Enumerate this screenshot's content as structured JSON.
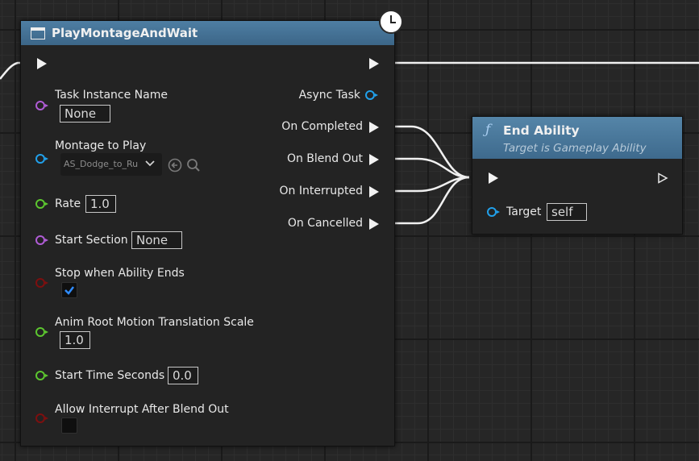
{
  "play_node": {
    "title": "PlayMontageAndWait",
    "inputs": {
      "task_instance_name": {
        "label": "Task Instance Name",
        "value": "None"
      },
      "montage_to_play": {
        "label": "Montage to Play",
        "value": "AS_Dodge_to_Ru"
      },
      "rate": {
        "label": "Rate",
        "value": "1.0"
      },
      "start_section": {
        "label": "Start Section",
        "value": "None"
      },
      "stop_when_ability_ends": {
        "label": "Stop when Ability Ends",
        "checked": true
      },
      "anim_root_motion": {
        "label": "Anim Root Motion Translation Scale",
        "value": "1.0"
      },
      "start_time_seconds": {
        "label": "Start Time Seconds",
        "value": "0.0"
      },
      "allow_interrupt": {
        "label": "Allow Interrupt After Blend Out",
        "checked": false
      }
    },
    "outputs": {
      "async_task": "Async Task",
      "on_completed": "On Completed",
      "on_blend_out": "On Blend Out",
      "on_interrupted": "On Interrupted",
      "on_cancelled": "On Cancelled"
    }
  },
  "end_ability_node": {
    "title": "End Ability",
    "subtitle": "Target is Gameplay Ability",
    "target_label": "Target",
    "target_value": "self"
  },
  "icons": [
    "window-icon",
    "clock-icon",
    "function-icon",
    "chevron-down-icon",
    "browse-arrow-icon",
    "search-icon",
    "checkmark-icon"
  ],
  "colors": {
    "node_header": "#4e7ea3",
    "pin_string": "#b05cd6",
    "pin_object": "#21a0ea",
    "pin_float": "#5cc62f",
    "pin_bool": "#7d0f0f",
    "exec_wire": "#f2f2f2"
  }
}
